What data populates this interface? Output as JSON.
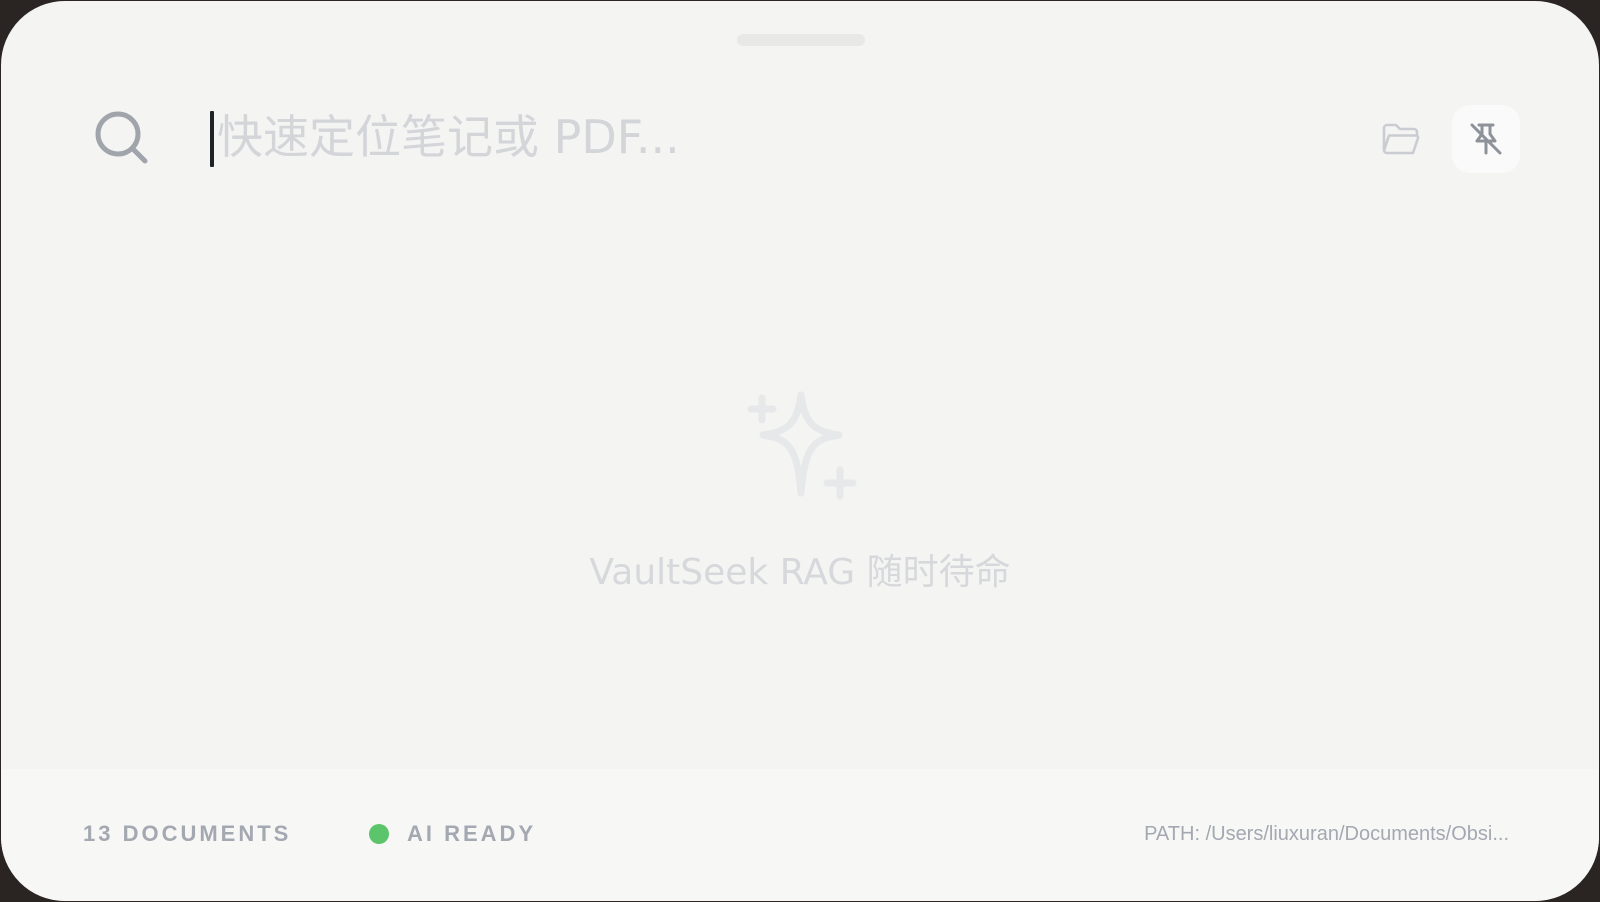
{
  "search": {
    "placeholder": "快速定位笔记或 PDF...",
    "value": ""
  },
  "toolbar": {
    "folder_icon": "folder-open-icon",
    "pin_icon": "pin-off-icon"
  },
  "empty_state": {
    "icon": "sparkles-icon",
    "message": "VaultSeek RAG 随时待命"
  },
  "footer": {
    "document_count": "13 DOCUMENTS",
    "status_label": "AI READY",
    "status_color": "#5cc46a",
    "path": "PATH: /Users/liuxuran/Documents/Obsi..."
  }
}
